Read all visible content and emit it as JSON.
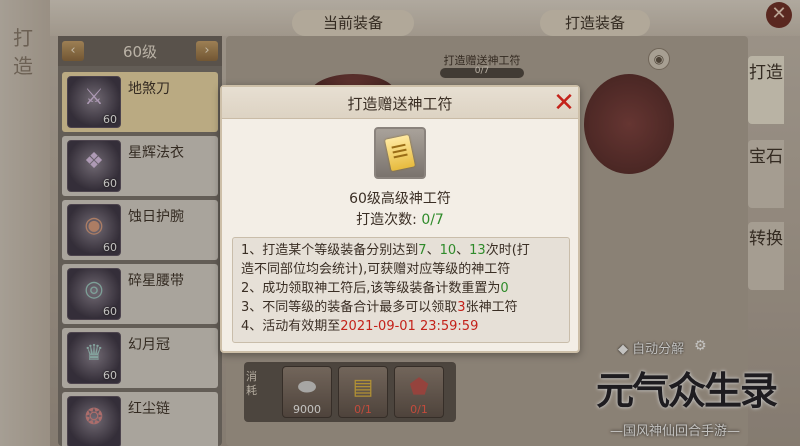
{
  "left_rail": {
    "title": "打造"
  },
  "equipment_list": {
    "level_label": "60级",
    "prev_arrow": "‹",
    "next_arrow": "›",
    "items": [
      {
        "name": "地煞刀",
        "level": "60",
        "selected": true,
        "icon": "blade-icon"
      },
      {
        "name": "星辉法衣",
        "level": "60",
        "selected": false,
        "icon": "robe-icon"
      },
      {
        "name": "蚀日护腕",
        "level": "60",
        "selected": false,
        "icon": "bracer-icon"
      },
      {
        "name": "碎星腰带",
        "level": "60",
        "selected": false,
        "icon": "belt-icon"
      },
      {
        "name": "幻月冠",
        "level": "60",
        "selected": false,
        "icon": "crown-icon"
      },
      {
        "name": "红尘链",
        "level": "",
        "selected": false,
        "icon": "necklace-icon"
      }
    ]
  },
  "main": {
    "current_equip_label": "当前装备",
    "forge_equip_label": "打造装备",
    "bonus_progress_label": "打造赠送神工符",
    "bonus_progress_value": "0/7",
    "auto_split_label": "自动分解",
    "materials_label": "消耗",
    "materials": [
      {
        "icon": "silver-ingot-icon",
        "count": "9000",
        "insufficient": false
      },
      {
        "icon": "talisman-icon",
        "count": "0/1",
        "insufficient": true
      },
      {
        "icon": "red-stone-icon",
        "count": "0/1",
        "insufficient": true
      }
    ]
  },
  "side_tabs": [
    {
      "label": "打造",
      "active": true
    },
    {
      "label": "宝石",
      "active": false
    },
    {
      "label": "转换",
      "active": false
    }
  ],
  "modal": {
    "title": "打造赠送神工符",
    "item_name": "60级高级神工符",
    "forge_count_label": "打造次数:",
    "forge_count_value": "0/7",
    "rules": {
      "line1_a": "1、打造某个等级装备分别达到",
      "line1_n1": "7",
      "line1_sep1": "、",
      "line1_n2": "10",
      "line1_sep2": "、",
      "line1_n3": "13",
      "line1_b": "次时(打",
      "line2": "造不同部位均会统计),可获赠对应等级的神工符",
      "line3_a": "2、成功领取神工符后,该等级装备计数重置为",
      "line3_n": "0",
      "line4_a": "3、不同等级的装备合计最多可以领取",
      "line4_n": "3",
      "line4_b": "张神工符",
      "line5_a": "4、活动有效期至",
      "line5_date": "2021-09-01 23:59:59"
    }
  },
  "logo": {
    "title": "元气众生录",
    "subtitle": "—国风神仙回合手游—"
  },
  "colors": {
    "accent_green": "#2f8b2a",
    "accent_red": "#c4221a",
    "selected_item": "#f3deaa"
  }
}
